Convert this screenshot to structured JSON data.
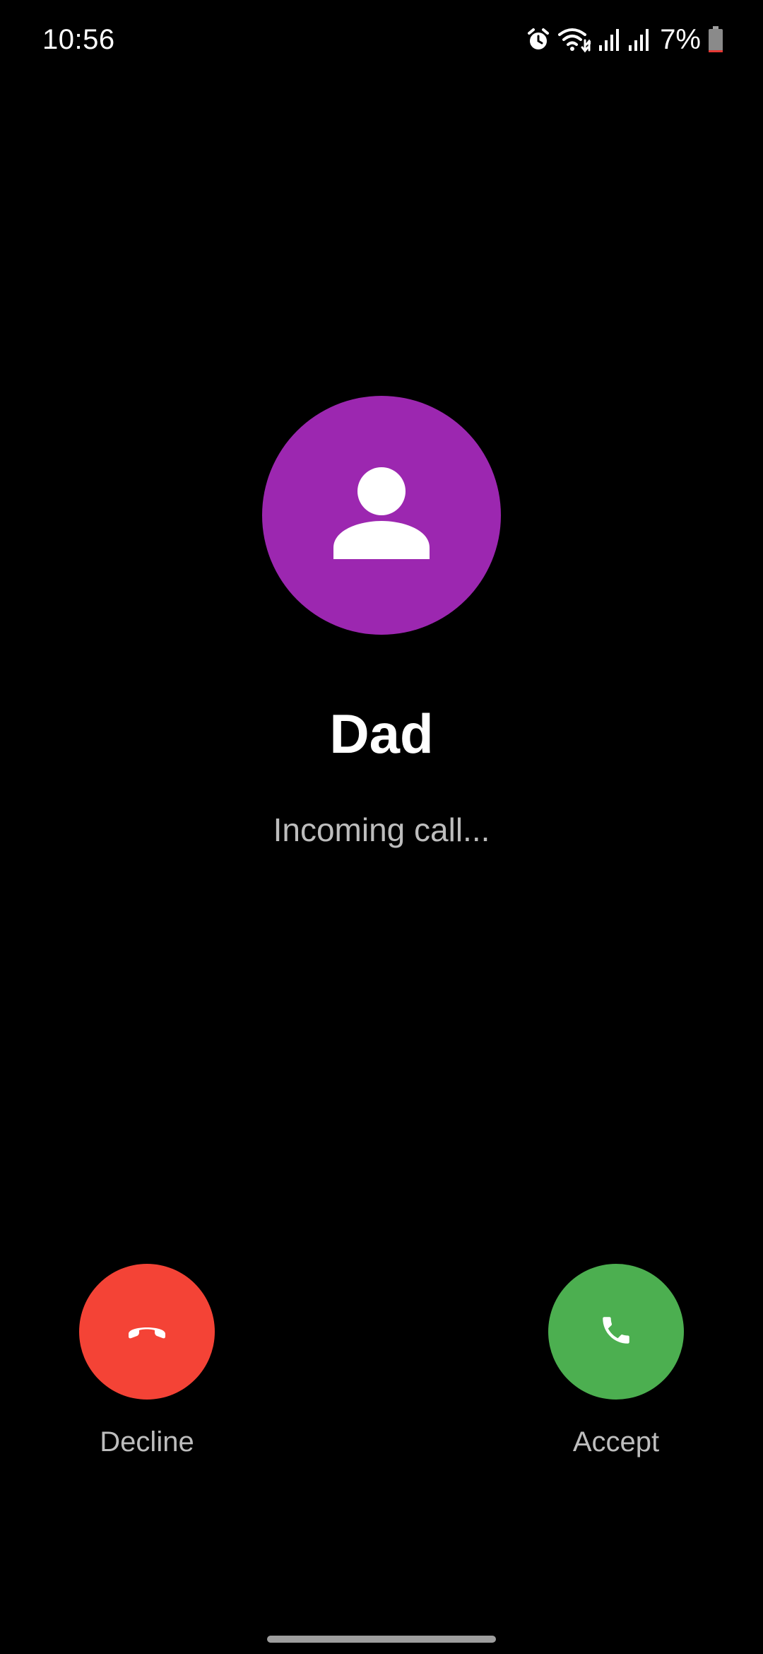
{
  "status_bar": {
    "time": "10:56",
    "battery_percent": "7%",
    "battery_level": 0.07,
    "icons": [
      "alarm-icon",
      "wifi-icon",
      "signal-icon",
      "signal-icon",
      "battery-icon"
    ]
  },
  "caller": {
    "name": "Dad",
    "status": "Incoming call...",
    "avatar_icon": "person-icon",
    "avatar_color": "#9C27B0"
  },
  "actions": {
    "decline": {
      "label": "Decline",
      "icon": "call-end-icon",
      "color": "#F44336"
    },
    "accept": {
      "label": "Accept",
      "icon": "phone-icon",
      "color": "#4CAF50"
    }
  },
  "colors": {
    "background": "#000000",
    "battery_low": "#E53935"
  }
}
